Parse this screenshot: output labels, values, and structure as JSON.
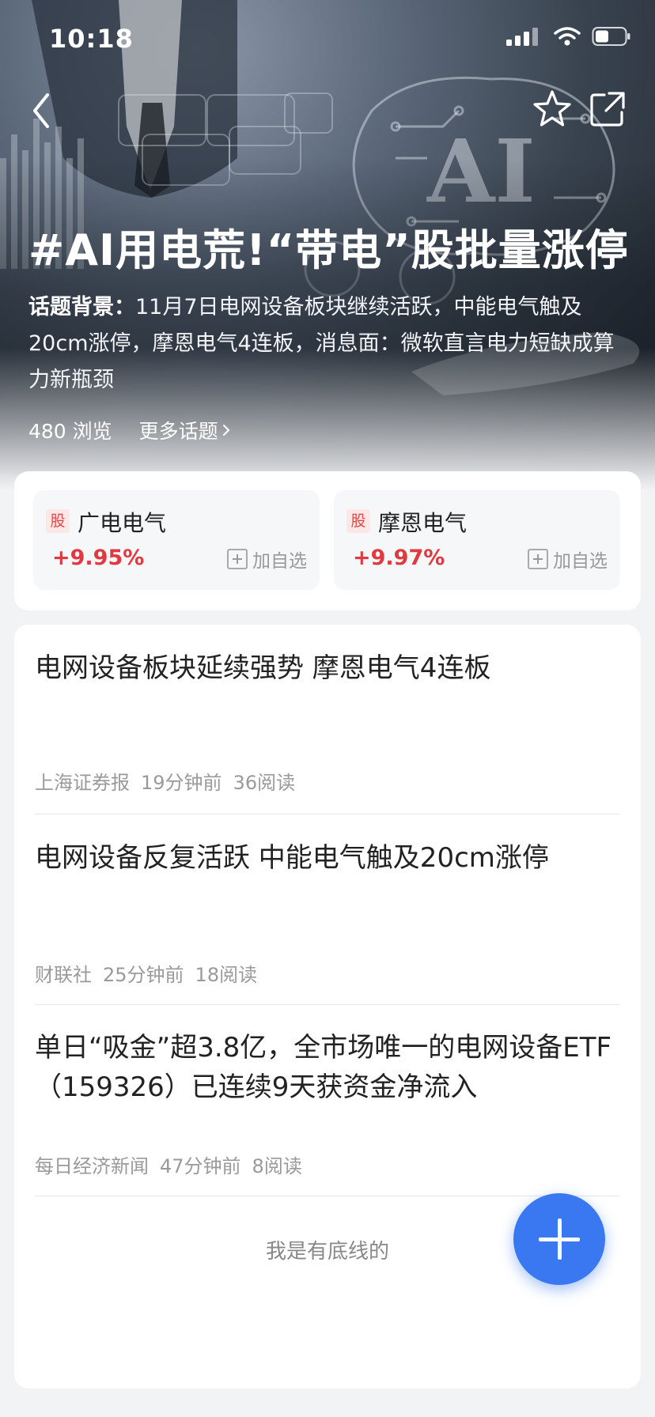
{
  "status_bar": {
    "time": "10:18"
  },
  "icons": {
    "back": "back-arrow-icon",
    "star": "star-icon",
    "share": "share-icon",
    "signal": "signal-icon",
    "wifi": "wifi-icon",
    "battery": "battery-icon",
    "stock_tag": "stock-tag-icon",
    "add_watch": "add-box-icon",
    "fab": "plus-icon"
  },
  "topic": {
    "title": "#AI用电荒!“带电”股批量涨停",
    "background_label": "话题背景：",
    "background_text": "11月7日电网设备板块继续活跃，中能电气触及20cm涨停，摩恩电气4连板，消息面：微软直言电力短缺成算力新瓶颈",
    "views": "480 浏览",
    "more_topics": "更多话题"
  },
  "stocks": [
    {
      "tag": "股",
      "name": "广电电气",
      "change": "+9.95%",
      "add_label": "加自选"
    },
    {
      "tag": "股",
      "name": "摩恩电气",
      "change": "+9.97%",
      "add_label": "加自选"
    }
  ],
  "news": [
    {
      "title": "电网设备板块延续强势 摩恩电气4连板",
      "source": "上海证券报",
      "time": "19分钟前",
      "reads": "36阅读"
    },
    {
      "title": "电网设备反复活跃 中能电气触及20cm涨停",
      "source": "财联社",
      "time": "25分钟前",
      "reads": "18阅读"
    },
    {
      "title": "单日“吸金”超3.8亿，全市场唯一的电网设备ETF（159326）已连续9天获资金净流入",
      "source": "每日经济新闻",
      "time": "47分钟前",
      "reads": "8阅读"
    }
  ],
  "end_text": "我是有底线的",
  "colors": {
    "accent": "#3a78f2",
    "rise": "#e0393f"
  }
}
